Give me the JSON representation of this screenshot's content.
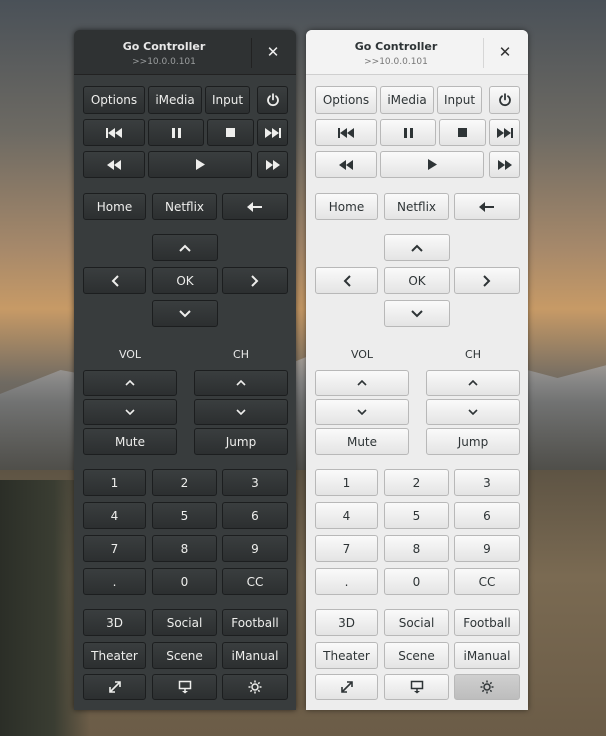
{
  "window": {
    "title": "Go Controller",
    "subtitle": ">>10.0.0.101",
    "close_glyph": "✕"
  },
  "top_row": [
    "Options",
    "iMedia",
    "Input"
  ],
  "icons": {
    "power": "power-icon",
    "skip_back": "skip-back-icon",
    "pause": "pause-icon",
    "stop": "stop-icon",
    "skip_forward": "skip-forward-icon",
    "rewind": "rewind-icon",
    "play": "play-icon",
    "fast_forward": "fast-forward-icon",
    "back": "back-arrow-icon",
    "up": "chevron-up-icon",
    "down": "chevron-down-icon",
    "left": "chevron-left-icon",
    "right": "chevron-right-icon",
    "fullscreen": "fullscreen-icon",
    "display": "display-icon",
    "settings": "brightness-icon"
  },
  "nav_row": [
    "Home",
    "Netflix"
  ],
  "dpad_ok": "OK",
  "vol_label": "VOL",
  "ch_label": "CH",
  "mute": "Mute",
  "jump": "Jump",
  "keypad": [
    "1",
    "2",
    "3",
    "4",
    "5",
    "6",
    "7",
    "8",
    "9",
    ".",
    "0",
    "CC"
  ],
  "extras_row1": [
    "3D",
    "Social",
    "Football"
  ],
  "extras_row2": [
    "Theater",
    "Scene",
    "iManual"
  ],
  "colors": {
    "dark_panel": "#383c3d",
    "light_panel": "#ededed"
  }
}
